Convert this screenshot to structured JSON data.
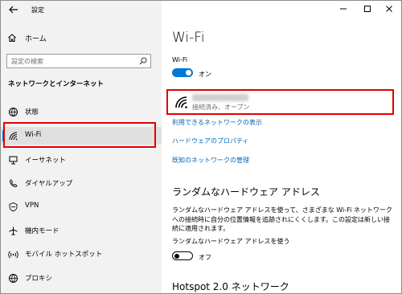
{
  "window": {
    "title": "設定"
  },
  "sidebar": {
    "home_label": "ホーム",
    "search_placeholder": "設定の検索",
    "section_title": "ネットワークとインターネット",
    "items": [
      {
        "label": "状態",
        "icon": "globe-icon"
      },
      {
        "label": "Wi-Fi",
        "icon": "wifi-icon",
        "active": true
      },
      {
        "label": "イーサネット",
        "icon": "ethernet-icon"
      },
      {
        "label": "ダイヤルアップ",
        "icon": "phone-icon"
      },
      {
        "label": "VPN",
        "icon": "vpn-icon"
      },
      {
        "label": "機内モード",
        "icon": "airplane-icon"
      },
      {
        "label": "モバイル ホットスポット",
        "icon": "hotspot-icon"
      },
      {
        "label": "プロキシ",
        "icon": "globe-icon"
      }
    ]
  },
  "main": {
    "title": "Wi-Fi",
    "wifi_toggle": {
      "label": "Wi-Fi",
      "state_text": "オン"
    },
    "network": {
      "status": "接続済み、オープン"
    },
    "links": {
      "available": "利用できるネットワークの表示",
      "hardware": "ハードウェアのプロパティ",
      "known": "既知のネットワークの管理"
    },
    "random_hw": {
      "heading": "ランダムなハードウェア アドレス",
      "description": "ランダムなハードウェア アドレスを使って、さまざまな Wi-Fi ネットワークへの接続時に自分の位置情報を追跡されにくくします。この設定は新しい接続に適用されます。",
      "toggle_label": "ランダムなハードウェア アドレスを使う",
      "state_text": "オフ"
    },
    "hotspot_heading": "Hotspot 2.0 ネットワーク"
  },
  "colors": {
    "accent": "#0078d4",
    "highlight": "#e00000",
    "link": "#0066b4"
  }
}
